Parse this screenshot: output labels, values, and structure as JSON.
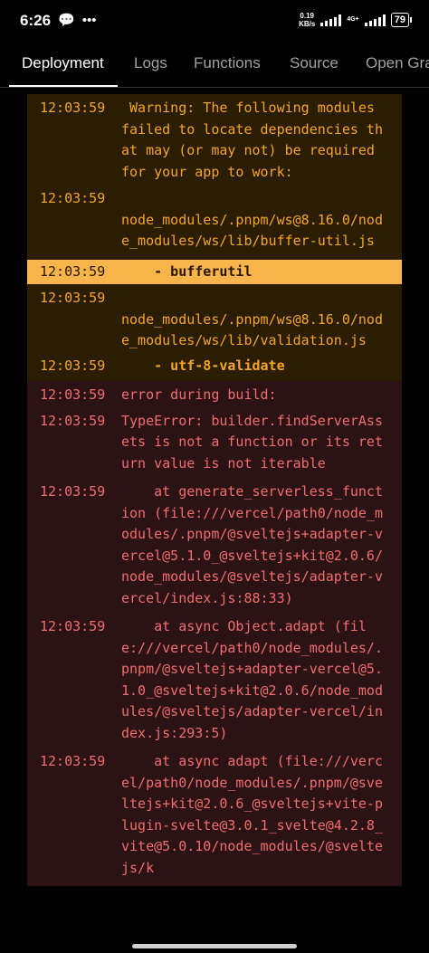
{
  "status_bar": {
    "time": "6:26",
    "speed_value": "0.19",
    "speed_unit": "KB/s",
    "network": "4G+",
    "battery": "79"
  },
  "tabs": [
    {
      "label": "Deployment",
      "active": true
    },
    {
      "label": "Logs",
      "active": false
    },
    {
      "label": "Functions",
      "active": false
    },
    {
      "label": "Source",
      "active": false
    },
    {
      "label": "Open Gra",
      "active": false
    }
  ],
  "log": [
    {
      "time": "12:03:59",
      "text": " Warning: The following modules failed to locate dependencies that may (or may not) be required for your app to work:",
      "level": "warn"
    },
    {
      "time": "12:03:59",
      "text": "\nnode_modules/.pnpm/ws@8.16.0/node_modules/ws/lib/buffer-util.js",
      "level": "warn"
    },
    {
      "time": "12:03:59",
      "text": "    - bufferutil",
      "level": "highlight"
    },
    {
      "time": "12:03:59",
      "text": "\nnode_modules/.pnpm/ws@8.16.0/node_modules/ws/lib/validation.js",
      "level": "warn"
    },
    {
      "time": "12:03:59",
      "text": "    - utf-8-validate",
      "level": "warn-bold"
    },
    {
      "time": "12:03:59",
      "text": "error during build:",
      "level": "error"
    },
    {
      "time": "12:03:59",
      "text": "TypeError: builder.findServerAssets is not a function or its return value is not iterable",
      "level": "error"
    },
    {
      "time": "12:03:59",
      "text": "    at generate_serverless_function (file:///vercel/path0/node_modules/.pnpm/@sveltejs+adapter-vercel@5.1.0_@sveltejs+kit@2.0.6/node_modules/@sveltejs/adapter-vercel/index.js:88:33)",
      "level": "error"
    },
    {
      "time": "12:03:59",
      "text": "    at async Object.adapt (file:///vercel/path0/node_modules/.pnpm/@sveltejs+adapter-vercel@5.1.0_@sveltejs+kit@2.0.6/node_modules/@sveltejs/adapter-vercel/index.js:293:5)",
      "level": "error"
    },
    {
      "time": "12:03:59",
      "text": "    at async adapt (file:///vercel/path0/node_modules/.pnpm/@sveltejs+kit@2.0.6_@sveltejs+vite-plugin-svelte@3.0.1_svelte@4.2.8_vite@5.0.10/node_modules/@sveltejs/k",
      "level": "error"
    }
  ]
}
